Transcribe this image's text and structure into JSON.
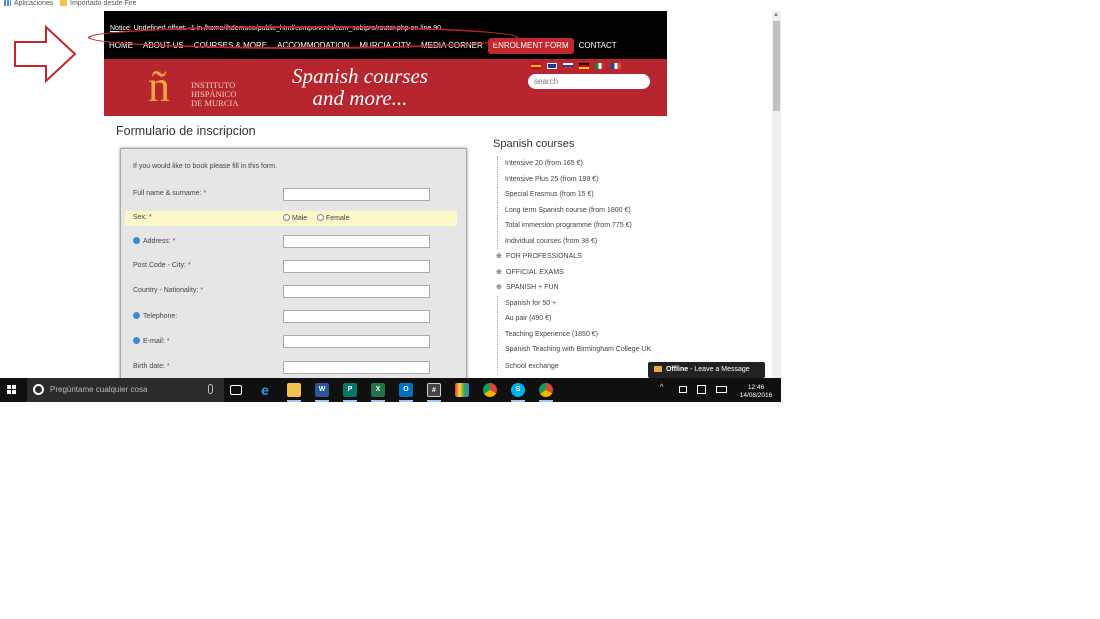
{
  "bookmarks": [
    {
      "label": "Aplicaciones",
      "icon": "apps-grid-icon"
    },
    {
      "label": "Importado desde Fire",
      "icon": "folder-icon"
    }
  ],
  "site": {
    "notice": {
      "prefix": "Notice",
      "text": ": Undefined offset: -1 in /home/ihdemuco/public_html/components/com_sobipro/router.php on line 90"
    },
    "nav": [
      "HOME",
      "ABOUT US",
      "COURSES & MORE",
      "ACCOMMODATION",
      "MURCIA CITY",
      "MEDIA CORNER",
      "ENROLMENT FORM",
      "CONTACT"
    ],
    "nav_active": "ENROLMENT FORM",
    "logo": {
      "letter": "ñ",
      "line1": "INSTITUTO",
      "line2": "HISPÁNICO",
      "line3": "DE MURCIA"
    },
    "slogan": {
      "line1": "Spanish courses",
      "line2": "and more..."
    },
    "flags": [
      "es-flag-icon",
      "uk-flag-icon",
      "ru-flag-icon",
      "de-flag-icon",
      "it-flag-icon",
      "fr-flag-icon"
    ],
    "search_placeholder": "search",
    "colors": {
      "brand_red": "#b7252e",
      "accent_orange": "#f3a73b",
      "nav_bg": "#000000"
    }
  },
  "form": {
    "title": "Formulario de inscripcion",
    "intro": "If you would like to book please fill in this form.",
    "required_mark": "*",
    "fields": [
      {
        "label": "Full name & surname:",
        "required": true,
        "globe": false
      },
      {
        "label": "Sex:",
        "required": true,
        "globe": false
      },
      {
        "label": "Address:",
        "required": true,
        "globe": true
      },
      {
        "label": "Post Code - City:",
        "required": true,
        "globe": false
      },
      {
        "label": "Country - Nationality:",
        "required": true,
        "globe": false
      },
      {
        "label": "Telephone:",
        "required": false,
        "globe": true
      },
      {
        "label": "E-mail:",
        "required": true,
        "globe": true
      },
      {
        "label": "Birth date:",
        "required": true,
        "globe": false
      }
    ],
    "sex_options": [
      "Male",
      "Female"
    ]
  },
  "sidebar": {
    "title": "Spanish courses",
    "items": [
      {
        "label": "Intensive 20 (from 165 €)",
        "group": false
      },
      {
        "label": "Intensive Plus 25 (from 199 €)",
        "group": false
      },
      {
        "label": "Special Erasmus (from 15 €)",
        "group": false
      },
      {
        "label": "Long term Spanish course (from 1800 €)",
        "group": false
      },
      {
        "label": "Total immersion programme (from 775 €)",
        "group": false
      },
      {
        "label": "Individual courses (from 38 €)",
        "group": false
      },
      {
        "label": "FOR PROFESSIONALS",
        "group": true
      },
      {
        "label": "OFFICIAL EXAMS",
        "group": true
      },
      {
        "label": "SPANISH + FUN",
        "group": true
      },
      {
        "label": "Spanish for 50 +",
        "group": false
      },
      {
        "label": "Au pair (490 €)",
        "group": false
      },
      {
        "label": "Teaching Experience (1850 €)",
        "group": false
      },
      {
        "label": "Spanish Teaching with Birmingham College UK",
        "group": false
      },
      {
        "label": "School exchange",
        "group": false
      }
    ]
  },
  "chat_widget": {
    "status": "Offline",
    "message": " - Leave a Message"
  },
  "taskbar": {
    "search_placeholder": "Pregúntame cualquier cosa",
    "apps": [
      "task-view-icon",
      "edge-icon",
      "file-explorer-icon",
      "word-icon",
      "publisher-icon",
      "excel-icon",
      "outlook-icon",
      "calculator-icon",
      "app-grid-icon",
      "chrome-icon",
      "skype-icon",
      "chrome-profile-icon"
    ],
    "time": "12:46",
    "date": "14/08/2016"
  }
}
